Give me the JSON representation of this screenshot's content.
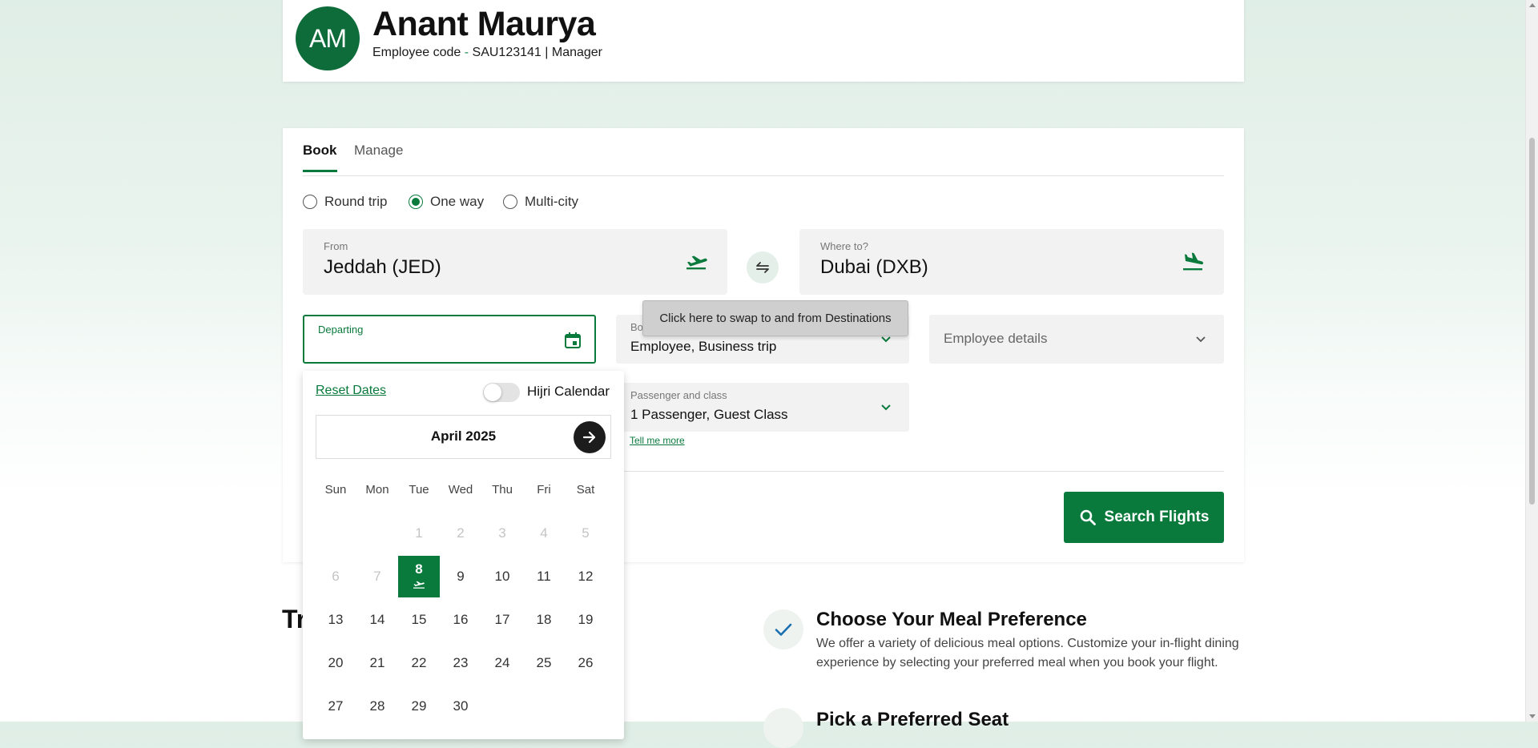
{
  "profile": {
    "initials": "AM",
    "name": "Anant Maurya",
    "code_label": "Employee code",
    "code_sep": " - ",
    "code_value": "SAU123141",
    "role_sep": " | ",
    "role": "Manager"
  },
  "tabs": [
    {
      "label": "Book",
      "active": true
    },
    {
      "label": "Manage",
      "active": false
    }
  ],
  "trip_types": [
    {
      "label": "Round trip",
      "selected": false
    },
    {
      "label": "One way",
      "selected": true
    },
    {
      "label": "Multi-city",
      "selected": false
    }
  ],
  "from": {
    "label": "From",
    "value": "Jeddah (JED)",
    "icon": "takeoff-icon"
  },
  "to": {
    "label": "Where to?",
    "value": "Dubai (DXB)",
    "icon": "landing-icon"
  },
  "swap_tooltip": "Click here to swap to and from Destinations",
  "departing": {
    "label": "Departing",
    "value": ""
  },
  "booking_type": {
    "label": "Bo",
    "value": "Employee, Business trip"
  },
  "employee_details": {
    "placeholder": "Employee details"
  },
  "passenger": {
    "label": "Passenger and class",
    "value": "1 Passenger, Guest Class",
    "link": "Tell me more"
  },
  "search_button": "Search Flights",
  "calendar": {
    "reset_label": "Reset Dates",
    "hijri_label": "Hijri Calendar",
    "hijri_enabled": false,
    "month": "April 2025",
    "weekdays": [
      "Sun",
      "Mon",
      "Tue",
      "Wed",
      "Thu",
      "Fri",
      "Sat"
    ],
    "first_weekday_index": 2,
    "days_in_month": 30,
    "past_through": 7,
    "selected_day": 8
  },
  "sections": {
    "cut_heading": "Tr",
    "meal_title": "Choose Your Meal Preference",
    "meal_text": "We offer a variety of delicious meal options. Customize your in-flight dining experience by selecting your preferred meal when you book your flight.",
    "seat_title": "Pick a Preferred Seat"
  },
  "colors": {
    "brand_green": "#0a7a3c",
    "avatar_green": "#0e6b3a"
  }
}
